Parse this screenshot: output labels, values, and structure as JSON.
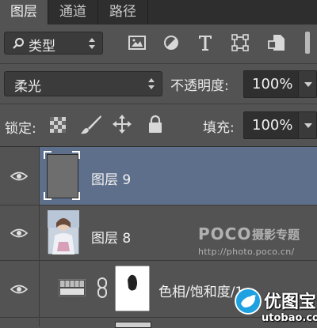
{
  "tabs": [
    {
      "label": "图层",
      "active": true
    },
    {
      "label": "通道",
      "active": false
    },
    {
      "label": "路径",
      "active": false
    }
  ],
  "filter": {
    "kind_label": "类型",
    "icons": [
      "image-filter-icon",
      "adjustment-filter-icon",
      "type-filter-icon",
      "shape-filter-icon",
      "smart-object-filter-icon"
    ]
  },
  "blend": {
    "mode": "柔光",
    "opacity_label": "不透明度:",
    "opacity_value": "100%"
  },
  "lock": {
    "label": "锁定:",
    "icons": [
      "lock-transparent-icon",
      "lock-image-icon",
      "lock-position-icon",
      "lock-all-icon"
    ],
    "fill_label": "填充:",
    "fill_value": "100%"
  },
  "layers": [
    {
      "name": "图层 9",
      "selected": true,
      "thumb": "gray"
    },
    {
      "name": "图层 8",
      "selected": false,
      "thumb": "photo"
    },
    {
      "name": "色相/饱和度/1",
      "selected": false,
      "thumb": "adjustment"
    }
  ],
  "watermark": {
    "poco": "POCO",
    "poco_cn": "摄影专题",
    "url": "http://photo.poco.cn/",
    "site_cn": "优图宝",
    "site_url": "utobao.com"
  },
  "colors": {
    "panel_bg": "#535353",
    "tab_bar_bg": "#2e2e2e",
    "selected_layer": "#5e6f8b",
    "logo_blue": "#1da1e0"
  }
}
